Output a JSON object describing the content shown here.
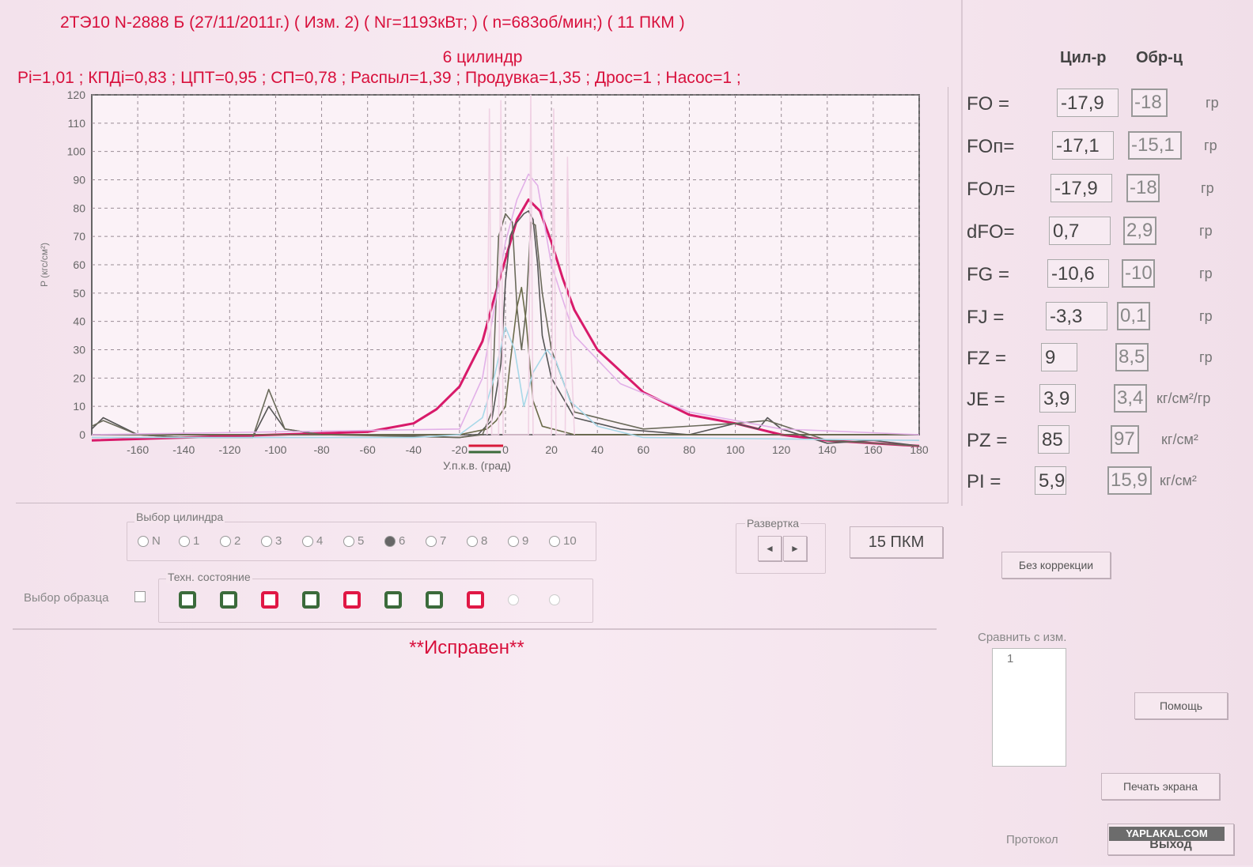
{
  "header": {
    "line1": "2ТЭ10  N-2888 Б  (27/11/2011г.) ( Изм. 2) ( Nг=1193кВт; ) ( n=683об/мин;) ( 11 ПКМ )",
    "line2": "6 цилиндр",
    "line3": "Pi=1,01 ; КПДi=0,83 ; ЦПТ=0,95 ; СП=0,78 ; Распыл=1,39 ; Продувка=1,35 ; Дрос=1 ; Насос=1 ;"
  },
  "chart_data": {
    "type": "line",
    "xlabel": "У.п.к.в. (град)",
    "ylabel": "P (кгс/см²)",
    "xlim": [
      -180,
      180
    ],
    "ylim": [
      0,
      120
    ],
    "x_ticks": [
      -160,
      -140,
      -120,
      -100,
      -80,
      -60,
      -40,
      -20,
      0,
      20,
      40,
      60,
      80,
      100,
      120,
      140,
      160,
      180
    ],
    "y_ticks": [
      0,
      10,
      20,
      30,
      40,
      50,
      60,
      70,
      80,
      90,
      100,
      110,
      120
    ],
    "grid": true,
    "series": [
      {
        "color": "#d81a6a",
        "points": [
          [
            -180,
            -2
          ],
          [
            -140,
            -1
          ],
          [
            -100,
            0
          ],
          [
            -60,
            1
          ],
          [
            -40,
            4
          ],
          [
            -30,
            9
          ],
          [
            -20,
            17
          ],
          [
            -10,
            33
          ],
          [
            -5,
            48
          ],
          [
            0,
            62
          ],
          [
            5,
            76
          ],
          [
            10,
            83
          ],
          [
            15,
            79
          ],
          [
            20,
            68
          ],
          [
            25,
            55
          ],
          [
            30,
            44
          ],
          [
            40,
            30
          ],
          [
            60,
            15
          ],
          [
            80,
            7
          ],
          [
            100,
            4
          ],
          [
            120,
            0
          ],
          [
            140,
            -2
          ],
          [
            180,
            -4
          ]
        ]
      },
      {
        "color": "#555555",
        "points": [
          [
            -180,
            2
          ],
          [
            -175,
            6
          ],
          [
            -160,
            0
          ],
          [
            -140,
            -1
          ],
          [
            -110,
            -1
          ],
          [
            -103,
            10
          ],
          [
            -96,
            2
          ],
          [
            -80,
            0
          ],
          [
            -60,
            0
          ],
          [
            -20,
            -1
          ],
          [
            -12,
            0
          ],
          [
            -6,
            5
          ],
          [
            -2,
            25
          ],
          [
            0,
            54
          ],
          [
            2,
            70
          ],
          [
            4,
            74
          ],
          [
            8,
            78
          ],
          [
            10,
            79
          ],
          [
            12,
            76
          ],
          [
            14,
            60
          ],
          [
            16,
            35
          ],
          [
            20,
            20
          ],
          [
            30,
            6
          ],
          [
            50,
            2
          ],
          [
            80,
            0
          ],
          [
            100,
            4
          ],
          [
            110,
            2
          ],
          [
            114,
            6
          ],
          [
            120,
            2
          ],
          [
            140,
            -3
          ],
          [
            160,
            -2
          ],
          [
            180,
            -4
          ]
        ]
      },
      {
        "color": "#6a6a5a",
        "points": [
          [
            -180,
            3
          ],
          [
            -175,
            5
          ],
          [
            -160,
            0
          ],
          [
            -140,
            -1
          ],
          [
            -110,
            -1
          ],
          [
            -103,
            16
          ],
          [
            -96,
            2
          ],
          [
            -80,
            0
          ],
          [
            -20,
            -1
          ],
          [
            -10,
            0
          ],
          [
            -6,
            8
          ],
          [
            -3,
            70
          ],
          [
            0,
            78
          ],
          [
            3,
            75
          ],
          [
            5,
            45
          ],
          [
            7,
            30
          ],
          [
            9,
            44
          ],
          [
            11,
            75
          ],
          [
            13,
            74
          ],
          [
            16,
            50
          ],
          [
            20,
            30
          ],
          [
            30,
            8
          ],
          [
            60,
            2
          ],
          [
            100,
            4
          ],
          [
            114,
            5
          ],
          [
            140,
            -2
          ],
          [
            180,
            -4
          ]
        ]
      },
      {
        "color": "#6b6b4a",
        "points": [
          [
            -180,
            0
          ],
          [
            -20,
            0
          ],
          [
            -8,
            2
          ],
          [
            -4,
            5
          ],
          [
            0,
            10
          ],
          [
            2,
            25
          ],
          [
            5,
            45
          ],
          [
            7,
            52
          ],
          [
            9,
            40
          ],
          [
            12,
            12
          ],
          [
            16,
            3
          ],
          [
            30,
            0
          ],
          [
            180,
            0
          ]
        ]
      },
      {
        "color": "#a8d8e8",
        "points": [
          [
            -180,
            -1
          ],
          [
            -40,
            -1
          ],
          [
            -20,
            0
          ],
          [
            -10,
            6
          ],
          [
            -5,
            20
          ],
          [
            0,
            38
          ],
          [
            4,
            30
          ],
          [
            8,
            10
          ],
          [
            12,
            22
          ],
          [
            18,
            30
          ],
          [
            22,
            26
          ],
          [
            28,
            12
          ],
          [
            40,
            3
          ],
          [
            60,
            -1
          ],
          [
            180,
            -2
          ]
        ]
      },
      {
        "color": "#e2b0e8",
        "points": [
          [
            -180,
            0
          ],
          [
            -20,
            2
          ],
          [
            -10,
            20
          ],
          [
            0,
            68
          ],
          [
            5,
            83
          ],
          [
            10,
            92
          ],
          [
            14,
            88
          ],
          [
            20,
            60
          ],
          [
            30,
            35
          ],
          [
            50,
            18
          ],
          [
            80,
            8
          ],
          [
            120,
            2
          ],
          [
            180,
            0
          ]
        ]
      },
      {
        "color": "#f0d2e4",
        "points": [
          [
            -8,
            0
          ],
          [
            -7,
            115
          ],
          [
            -6,
            0
          ],
          [
            -3,
            0
          ],
          [
            -2,
            118
          ],
          [
            -1,
            0
          ],
          [
            10,
            0
          ],
          [
            11,
            120
          ],
          [
            12,
            0
          ],
          [
            20,
            0
          ],
          [
            21,
            115
          ],
          [
            22,
            0
          ],
          [
            26,
            0
          ],
          [
            27,
            98
          ],
          [
            28,
            40
          ],
          [
            30,
            0
          ]
        ]
      }
    ]
  },
  "right": {
    "col1_header": "Цил-р",
    "col2_header": "Обр-ц",
    "rows": [
      {
        "label": "FO =",
        "v1": "-17,9",
        "v2": "-18",
        "unit": "гр"
      },
      {
        "label": "FOп=",
        "v1": "-17,1",
        "v2": "-15,1",
        "unit": "гр"
      },
      {
        "label": "FOл=",
        "v1": "-17,9",
        "v2": "-18",
        "unit": "гр"
      },
      {
        "label": "dFO=",
        "v1": "0,7",
        "v2": "2,9",
        "unit": "гр"
      },
      {
        "label": "FG =",
        "v1": "-10,6",
        "v2": "-10",
        "unit": "гр"
      },
      {
        "label": "FJ =",
        "v1": "-3,3",
        "v2": "0,1",
        "unit": "гр"
      },
      {
        "label": "FZ =",
        "v1": "9",
        "v2": "8,5",
        "unit": "гр"
      },
      {
        "label": "JE =",
        "v1": "3,9",
        "v2": "3,4",
        "unit": "кг/см²/гр"
      },
      {
        "label": "PZ =",
        "v1": "85",
        "v2": "97",
        "unit": "кг/см²"
      },
      {
        "label": "PI =",
        "v1": "5,9",
        "v2": "15,9",
        "unit": "кг/см²"
      }
    ]
  },
  "cylinder_select": {
    "label": "Выбор цилиндра",
    "options": [
      "N",
      "1",
      "2",
      "3",
      "4",
      "5",
      "6",
      "7",
      "8",
      "9",
      "10"
    ],
    "selected": "6"
  },
  "tech_state": {
    "label": "Техн. состояние",
    "leds": [
      "green",
      "green",
      "red",
      "green",
      "red",
      "green",
      "green",
      "red",
      "empty",
      "empty"
    ]
  },
  "sample_select_label": "Выбор образца",
  "sweep": {
    "label": "Развертка",
    "left": "◄",
    "right": "►"
  },
  "pkm_button": "15 ПКМ",
  "no_correction_button": "Без коррекции",
  "status_text": "**Исправен**",
  "compare": {
    "label": "Сравнить с изм.",
    "items": [
      "1"
    ]
  },
  "help_button": "Помощь",
  "print_button": "Печать экрана",
  "protocol_label": "Протокол",
  "exit_button": "Выход",
  "watermark": "YAPLAKAL.COM"
}
